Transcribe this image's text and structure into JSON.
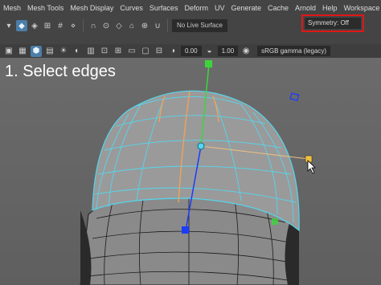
{
  "menubar": {
    "items": [
      "Mesh",
      "Mesh Tools",
      "Mesh Display",
      "Curves",
      "Surfaces",
      "Deform",
      "UV",
      "Generate",
      "Cache",
      "Arnold",
      "Help",
      "Workspace"
    ]
  },
  "toolbar": {
    "live_surface": "No Live Surface",
    "symmetry": "Symmetry: Off"
  },
  "panel": {
    "value_a": "0.00",
    "value_b": "1.00",
    "color_space": "sRGB gamma (legacy)"
  },
  "viewport": {
    "instruction": "1. Select edges"
  },
  "colors": {
    "highlight_border": "#e01616",
    "wireframe": "#54d7ee",
    "manipulator_y": "#3cd63c",
    "manipulator_z": "#1a3cff",
    "selected_edge": "#f0a25a"
  }
}
